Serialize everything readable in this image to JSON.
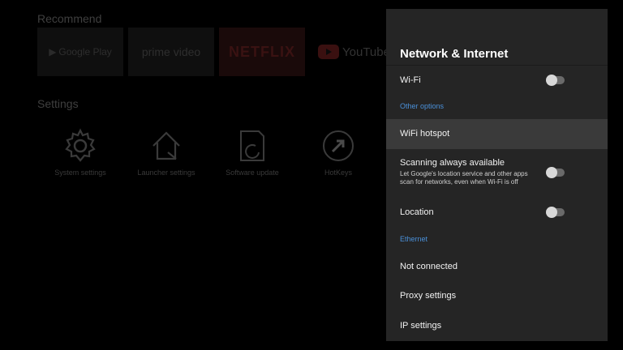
{
  "background": {
    "recommend_title": "Recommend",
    "recommend_tiles": [
      {
        "label": "Google Play",
        "icon": "google-play-icon"
      },
      {
        "label": "prime video",
        "icon": "prime-video-icon"
      },
      {
        "label": "NETFLIX",
        "icon": "netflix-icon"
      },
      {
        "label": "YouTube",
        "icon": "youtube-icon"
      }
    ],
    "settings_title": "Settings",
    "settings_items": [
      {
        "label": "System settings",
        "icon": "gear-icon"
      },
      {
        "label": "Launcher settings",
        "icon": "home-icon"
      },
      {
        "label": "Software update",
        "icon": "update-icon"
      },
      {
        "label": "HotKeys",
        "icon": "hotkey-arrow-icon"
      }
    ]
  },
  "panel": {
    "title": "Network & Internet",
    "wifi_label": "Wi-Fi",
    "wifi_enabled": false,
    "other_options_header": "Other options",
    "wifi_hotspot_label": "WiFi hotspot",
    "scanning_label": "Scanning always available",
    "scanning_desc_line1": "Let Google's location service and other apps",
    "scanning_desc_line2": "scan for networks, even when Wi-Fi is off",
    "scanning_enabled": false,
    "location_label": "Location",
    "location_enabled": false,
    "ethernet_header": "Ethernet",
    "not_connected_label": "Not connected",
    "proxy_label": "Proxy settings",
    "ip_label": "IP settings"
  },
  "colors": {
    "accent": "#4a90d9",
    "panel_bg": "#252525",
    "focused_row": "#3a3a3a"
  }
}
